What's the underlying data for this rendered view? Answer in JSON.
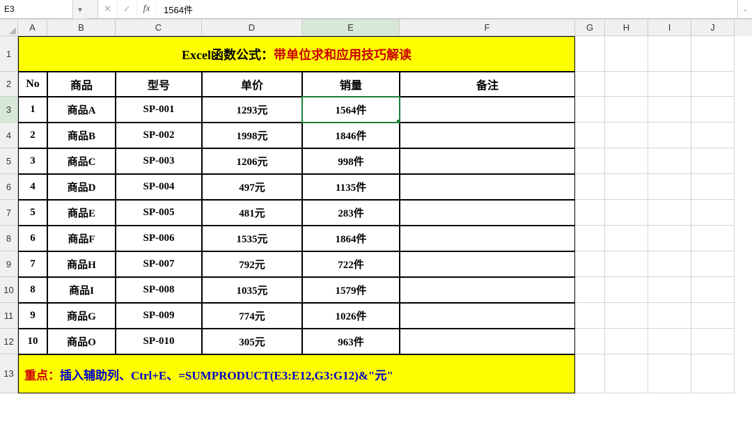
{
  "name_box": "E3",
  "formula_value": "1564件",
  "columns": [
    "A",
    "B",
    "C",
    "D",
    "E",
    "F",
    "G",
    "H",
    "I",
    "J"
  ],
  "row_nums": [
    1,
    2,
    3,
    4,
    5,
    6,
    7,
    8,
    9,
    10,
    11,
    12,
    13
  ],
  "title": {
    "black": "Excel函数公式：",
    "red": "带单位求和应用技巧解读"
  },
  "headers": {
    "a": "No",
    "b": "商品",
    "c": "型号",
    "d": "单价",
    "e": "销量",
    "f": "备注"
  },
  "rows": [
    {
      "no": "1",
      "name": "商品A",
      "model": "SP-001",
      "price": "1293元",
      "qty": "1564件"
    },
    {
      "no": "2",
      "name": "商品B",
      "model": "SP-002",
      "price": "1998元",
      "qty": "1846件"
    },
    {
      "no": "3",
      "name": "商品C",
      "model": "SP-003",
      "price": "1206元",
      "qty": "998件"
    },
    {
      "no": "4",
      "name": "商品D",
      "model": "SP-004",
      "price": "497元",
      "qty": "1135件"
    },
    {
      "no": "5",
      "name": "商品E",
      "model": "SP-005",
      "price": "481元",
      "qty": "283件"
    },
    {
      "no": "6",
      "name": "商品F",
      "model": "SP-006",
      "price": "1535元",
      "qty": "1864件"
    },
    {
      "no": "7",
      "name": "商品H",
      "model": "SP-007",
      "price": "792元",
      "qty": "722件"
    },
    {
      "no": "8",
      "name": "商品I",
      "model": "SP-008",
      "price": "1035元",
      "qty": "1579件"
    },
    {
      "no": "9",
      "name": "商品G",
      "model": "SP-009",
      "price": "774元",
      "qty": "1026件"
    },
    {
      "no": "10",
      "name": "商品O",
      "model": "SP-010",
      "price": "305元",
      "qty": "963件"
    }
  ],
  "footer": {
    "label": "重点：",
    "text": "插入辅助列、Ctrl+E、=SUMPRODUCT(E3:E12,G3:G12)&\"元\""
  },
  "selected": {
    "col": "E",
    "row": 3
  }
}
